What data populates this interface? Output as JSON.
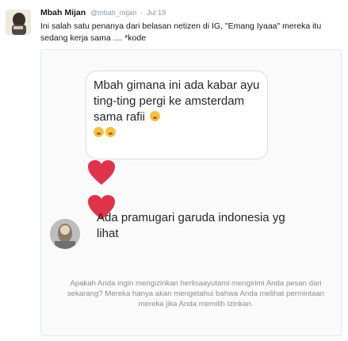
{
  "tweet": {
    "author_name": "Mbah Mijan",
    "author_handle": "@mbah_mijan",
    "separator": "·",
    "date": "Jul 19",
    "text": "Ini salah satu penanya dari belasan netizen di IG, \"Emang Iyaaa\" mereka itu sedang kerja sama .... *kode"
  },
  "media": {
    "dm_message": "Mbah gimana ini ada kabar ayu ting-ting pergi ke amsterdam sama rafii",
    "reply_message": "Ada pramugari garuda indonesia yg lihat",
    "request_notice": "Apakah Anda ingin mengizinkan herlisaayutami mengirimi Anda pesan dari sekarang? Mereka hanya akan mengetahui bahwa Anda melihat permintaan mereka jika Anda memilih Izinkan.",
    "heart_color": "#e0334b",
    "emoji_icon": "fearful-face-icon"
  },
  "colors": {
    "text_primary": "#14171a",
    "text_secondary": "#8899a6",
    "dm_text": "#262626",
    "request_text": "#8e8e8e"
  }
}
